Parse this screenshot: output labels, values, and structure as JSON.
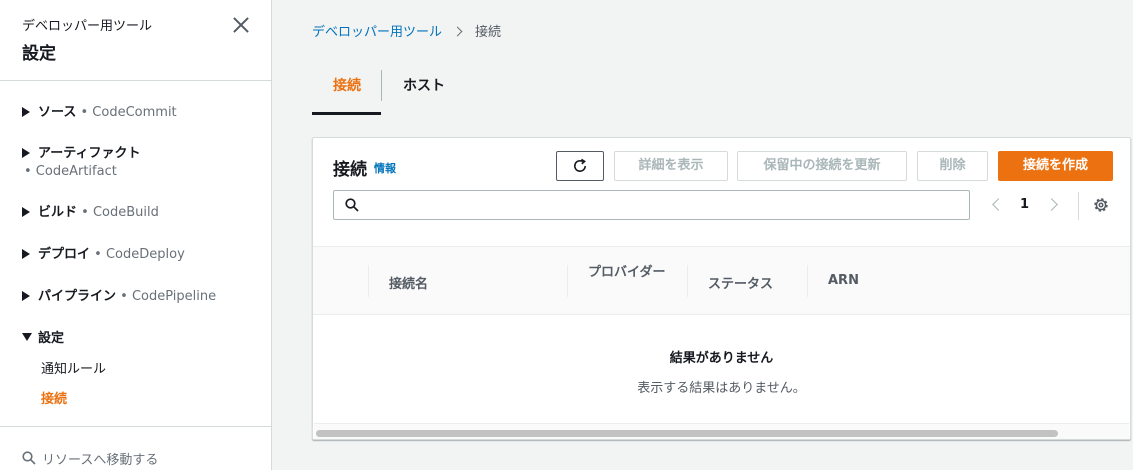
{
  "sidebar": {
    "subtitle": "デベロッパー用ツール",
    "title": "設定",
    "sections": [
      {
        "name": "ソース",
        "service": "• CodeCommit"
      },
      {
        "name": "アーティファクト",
        "service": "• CodeArtifact"
      },
      {
        "name": "ビルド",
        "service": "• CodeBuild"
      },
      {
        "name": "デプロイ",
        "service": "• CodeDeploy"
      },
      {
        "name": "パイプライン",
        "service": "• CodePipeline"
      },
      {
        "name": "設定",
        "service": ""
      }
    ],
    "settings_items": [
      "通知ルール",
      "接続"
    ],
    "search_placeholder": "リソースへ移動する"
  },
  "breadcrumb": {
    "parent": "デベロッパー用ツール",
    "current": "接続"
  },
  "tabs": [
    "接続",
    "ホスト"
  ],
  "panel": {
    "title": "接続",
    "info": "情報",
    "buttons": {
      "details": "詳細を表示",
      "update_pending": "保留中の接続を更新",
      "delete": "削除",
      "create": "接続を作成"
    },
    "search_placeholder": "",
    "page_number": "1",
    "columns": [
      "接続名",
      "プロバイダー",
      "ステータス",
      "ARN"
    ],
    "empty_title": "結果がありません",
    "empty_message": "表示する結果はありません。"
  },
  "colors": {
    "accent": "#ec7211",
    "link": "#0073bb"
  }
}
